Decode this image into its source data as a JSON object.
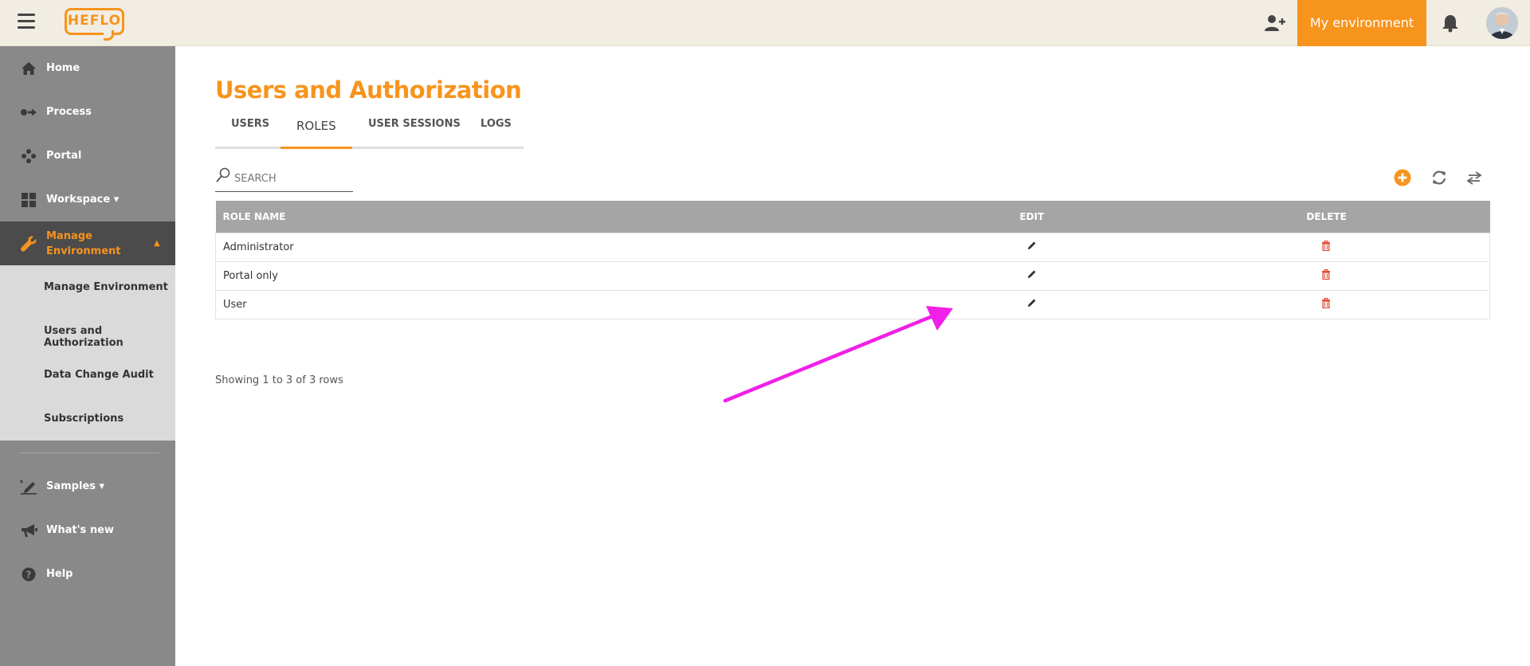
{
  "topbar": {
    "logo_text": "HEFLO",
    "env_button_label": "My environment",
    "accent_color": "#f7941d",
    "icons": [
      "menu-icon",
      "add-user-icon",
      "bell-icon"
    ]
  },
  "sidebar": {
    "items": [
      {
        "label": "Home",
        "icon": "home-icon"
      },
      {
        "label": "Process",
        "icon": "process-icon"
      },
      {
        "label": "Portal",
        "icon": "portal-icon"
      },
      {
        "label": "Workspace ▾",
        "icon": "grid-icon"
      },
      {
        "label": "Manage\nEnvironment",
        "icon": "wrench-icon",
        "active": true
      },
      {
        "label": "Samples ▾",
        "icon": "pen-icon"
      },
      {
        "label": "What's new",
        "icon": "megaphone-icon"
      },
      {
        "label": "Help",
        "icon": "help-icon"
      }
    ],
    "submenu": [
      "Manage Environment",
      "Users and Authorization",
      "Data Change Audit",
      "Subscriptions"
    ]
  },
  "main": {
    "title": "Users and Authorization",
    "tabs": [
      {
        "label": "USERS"
      },
      {
        "label": "ROLES",
        "active": true
      },
      {
        "label": "USER SESSIONS"
      },
      {
        "label": "LOGS"
      }
    ],
    "search": {
      "placeholder": "SEARCH",
      "value": ""
    },
    "table": {
      "headers": [
        "ROLE NAME",
        "EDIT",
        "DELETE"
      ],
      "rows": [
        {
          "role": "Administrator"
        },
        {
          "role": "Portal only"
        },
        {
          "role": "User"
        }
      ]
    },
    "pagination_info": "Showing 1 to 3 of 3 rows"
  },
  "annotation": {
    "arrow_color": "#f020e8"
  }
}
